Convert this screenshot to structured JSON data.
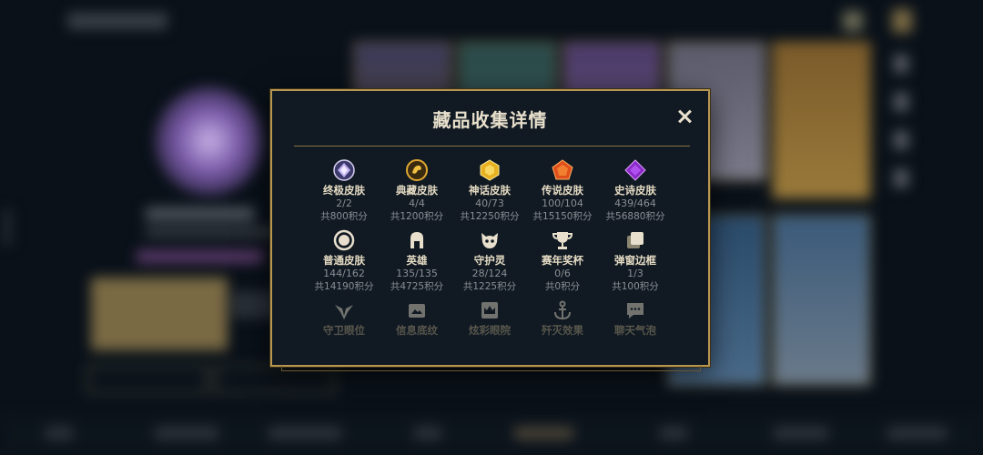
{
  "modal": {
    "title": "藏品收集详情",
    "rows": [
      [
        {
          "icon": "purple-crystal-icon",
          "name": "终极皮肤",
          "count": "2/2",
          "points": "共800积分"
        },
        {
          "icon": "gold-dragon-emblem-icon",
          "name": "典藏皮肤",
          "count": "4/4",
          "points": "共1200积分"
        },
        {
          "icon": "gold-gem-icon",
          "name": "神话皮肤",
          "count": "40/73",
          "points": "共12250积分"
        },
        {
          "icon": "orange-gem-icon",
          "name": "传说皮肤",
          "count": "100/104",
          "points": "共15150积分"
        },
        {
          "icon": "purple-gem-icon",
          "name": "史诗皮肤",
          "count": "439/464",
          "points": "共56880积分"
        }
      ],
      [
        {
          "icon": "circle-icon",
          "name": "普通皮肤",
          "count": "144/162",
          "points": "共14190积分"
        },
        {
          "icon": "helmet-icon",
          "name": "英雄",
          "count": "135/135",
          "points": "共4725积分"
        },
        {
          "icon": "cat-face-icon",
          "name": "守护灵",
          "count": "28/124",
          "points": "共1225积分"
        },
        {
          "icon": "trophy-icon",
          "name": "赛年奖杯",
          "count": "0/6",
          "points": "共0积分"
        },
        {
          "icon": "stacked-frames-icon",
          "name": "弹窗边框",
          "count": "1/3",
          "points": "共100积分"
        }
      ],
      [
        {
          "icon": "winged-emblem-icon",
          "name": "守卫眼位"
        },
        {
          "icon": "info-card-icon",
          "name": "信息底纹"
        },
        {
          "icon": "crown-badge-icon",
          "name": "炫彩眼院"
        },
        {
          "icon": "anchor-icon",
          "name": "歼灭效果"
        },
        {
          "icon": "chat-bubble-icon",
          "name": "聊天气泡"
        }
      ]
    ]
  }
}
